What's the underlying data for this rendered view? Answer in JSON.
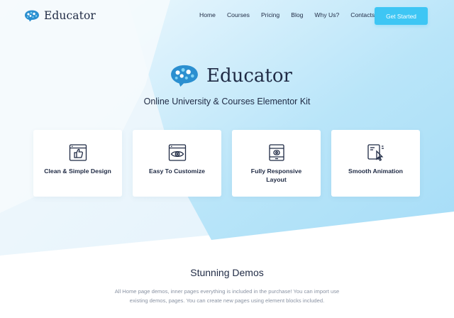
{
  "header": {
    "brand_name": "Educator",
    "logo_icon": "brain-chat-bubble-icon",
    "nav": [
      "Home",
      "Courses",
      "Pricing",
      "Blog",
      "Why Us?",
      "Contacts"
    ],
    "cta_label": "Get Started"
  },
  "hero": {
    "brand_name": "Educator",
    "tagline": "Online University & Courses Elementor Kit"
  },
  "features": [
    {
      "title": "Clean & Simple Design",
      "icon": "thumbs-up-window-icon"
    },
    {
      "title": "Easy To Customize",
      "icon": "eye-window-icon"
    },
    {
      "title": "Fully Responsive Layout",
      "icon": "responsive-devices-icon"
    },
    {
      "title": "Smooth Animation",
      "icon": "animation-cursor-icon"
    }
  ],
  "demos": {
    "title": "Stunning Demos",
    "text": "All Home page demos, inner pages everything is included in the purchase! You can import use existing demos, pages. You can create new pages using element blocks included."
  },
  "colors": {
    "accent": "#3ec6f4",
    "text": "#1f2a44",
    "muted": "#8a93a3",
    "hero_bg": "#e4f4fc"
  }
}
